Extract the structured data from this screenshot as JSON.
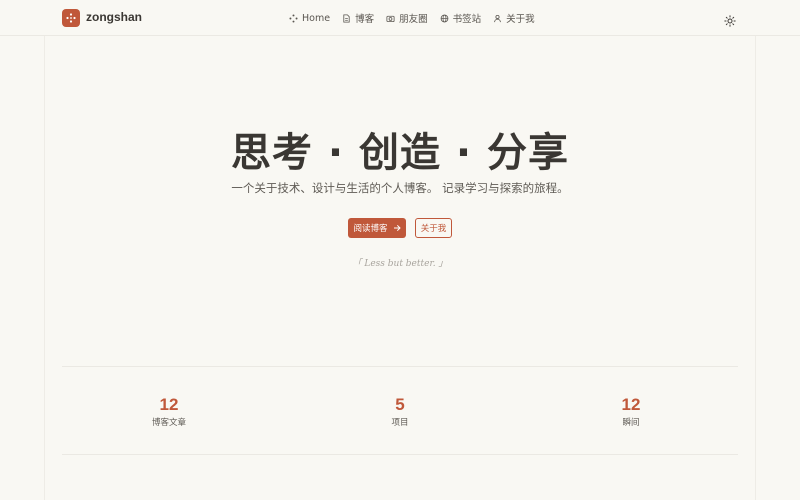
{
  "header": {
    "brand": "zongshan",
    "nav": [
      {
        "label": "Home",
        "icon": "sparkle-icon"
      },
      {
        "label": "博客",
        "icon": "document-icon"
      },
      {
        "label": "朋友圈",
        "icon": "camera-icon"
      },
      {
        "label": "书签站",
        "icon": "globe-icon"
      },
      {
        "label": "关于我",
        "icon": "user-icon"
      }
    ],
    "theme_icon": "sun-icon"
  },
  "hero": {
    "title": "思考 · 创造 · 分享",
    "subtitle": "一个关于技术、设计与生活的个人博客。 记录学习与探索的旅程。",
    "primary_button": "阅读博客",
    "secondary_button": "关于我",
    "quote": "「 Less but better. 」"
  },
  "stats": [
    {
      "value": "12",
      "label": "博客文章"
    },
    {
      "value": "5",
      "label": "项目"
    },
    {
      "value": "12",
      "label": "瞬间"
    }
  ],
  "colors": {
    "accent": "#c0583a",
    "background": "#f9f8f3",
    "text": "#3a3733"
  }
}
